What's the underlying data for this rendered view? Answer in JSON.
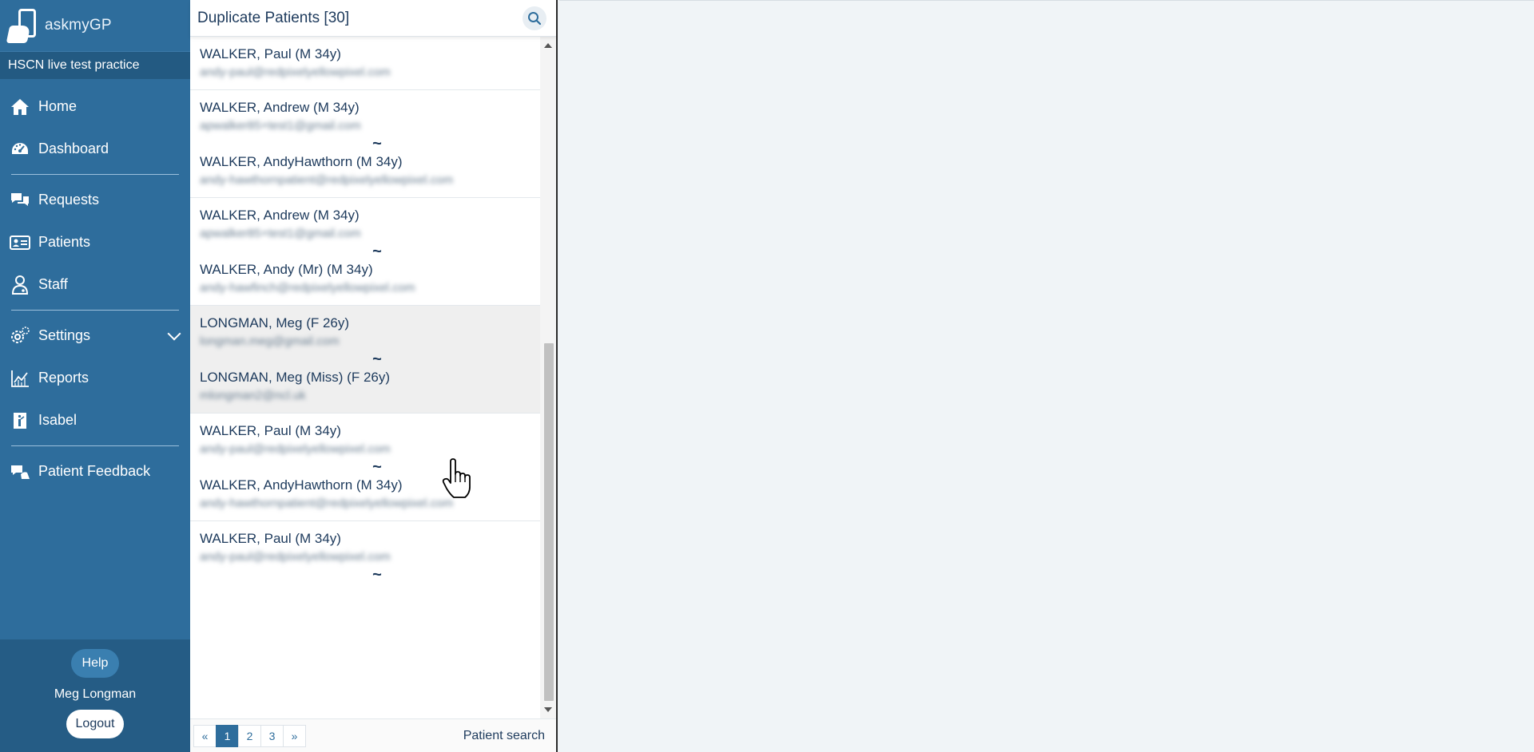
{
  "app": {
    "name": "askmyGP",
    "practice": "HSCN live test practice"
  },
  "nav": {
    "home": "Home",
    "dashboard": "Dashboard",
    "requests": "Requests",
    "patients": "Patients",
    "staff": "Staff",
    "settings": "Settings",
    "reports": "Reports",
    "isabel": "Isabel",
    "patient_feedback": "Patient Feedback"
  },
  "footer": {
    "help": "Help",
    "user": "Meg Longman",
    "logout": "Logout"
  },
  "panel": {
    "title": "Duplicate Patients [30]",
    "separator": "~",
    "groups": [
      {
        "patients": [
          {
            "name": "WALKER, Paul (M 34y)",
            "email": "andy-paul@redpixelyellowpixel.com"
          }
        ]
      },
      {
        "patients": [
          {
            "name": "WALKER, Andrew (M 34y)",
            "email": "apwalker85+test1@gmail.com"
          },
          {
            "name": "WALKER, AndyHawthorn (M 34y)",
            "email": "andy-hawthornpatient@redpixelyellowpixel.com"
          }
        ]
      },
      {
        "patients": [
          {
            "name": "WALKER, Andrew (M 34y)",
            "email": "apwalker85+test1@gmail.com"
          },
          {
            "name": "WALKER, Andy (Mr) (M 34y)",
            "email": "andy-hawfinch@redpixelyellowpixel.com"
          }
        ]
      },
      {
        "patients": [
          {
            "name": "LONGMAN, Meg (F 26y)",
            "email": "longman.meg@gmail.com"
          },
          {
            "name": "LONGMAN, Meg (Miss) (F 26y)",
            "email": "mlongman2@ncl.uk"
          }
        ]
      },
      {
        "patients": [
          {
            "name": "WALKER, Paul (M 34y)",
            "email": "andy-paul@redpixelyellowpixel.com"
          },
          {
            "name": "WALKER, AndyHawthorn (M 34y)",
            "email": "andy-hawthornpatient@redpixelyellowpixel.com"
          }
        ]
      },
      {
        "patients": [
          {
            "name": "WALKER, Paul (M 34y)",
            "email": "andy-paul@redpixelyellowpixel.com"
          }
        ]
      }
    ]
  },
  "pager": {
    "prev": "«",
    "pages": [
      "1",
      "2",
      "3"
    ],
    "current_page": "1",
    "next": "»",
    "patient_search": "Patient search"
  }
}
